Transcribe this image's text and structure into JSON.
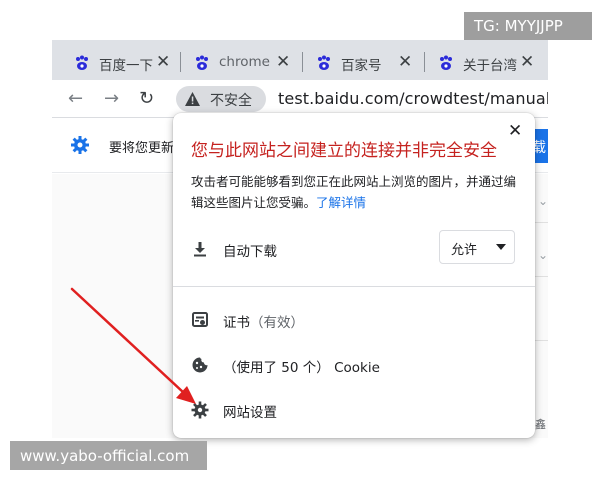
{
  "watermarks": {
    "top": "TG: MYYJJPP",
    "bottom": "www.yabo-official.com"
  },
  "tabs": [
    {
      "label": "百度一下",
      "icon": "baidu-paw-icon",
      "close": "✕"
    },
    {
      "label": "chrome",
      "icon": "baidu-paw-icon",
      "close": "✕"
    },
    {
      "label": "百家号",
      "icon": "baidu-paw-icon",
      "close": "✕"
    },
    {
      "label": "关于台湾",
      "icon": "baidu-paw-icon",
      "close": "✕"
    }
  ],
  "toolbar": {
    "back": "←",
    "forward": "→",
    "reload": "↻",
    "security_label": "不安全",
    "url": "test.baidu.com/crowdtest/manualTe"
  },
  "infobar": {
    "text": "要将您更新",
    "button": "载"
  },
  "popup": {
    "close": "✕",
    "title": "您与此网站之间建立的连接并非完全安全",
    "desc_text": "攻击者可能能够看到您正在此网站上浏览的图片，并通过编辑这些图片让您受骗。",
    "learn_more": "了解详情",
    "download_label": "自动下载",
    "download_select_value": "允许",
    "certificate_label": "证书",
    "certificate_status": "（有效）",
    "cookie_label_prefix": "（使用了 50 个）",
    "cookie_label": "Cookie",
    "site_settings_label": "网站设置"
  },
  "page_side": {
    "text": "鑫"
  },
  "colors": {
    "warning_red": "#c5221f",
    "link_blue": "#1a73e8",
    "arrow_red": "#e02020"
  }
}
